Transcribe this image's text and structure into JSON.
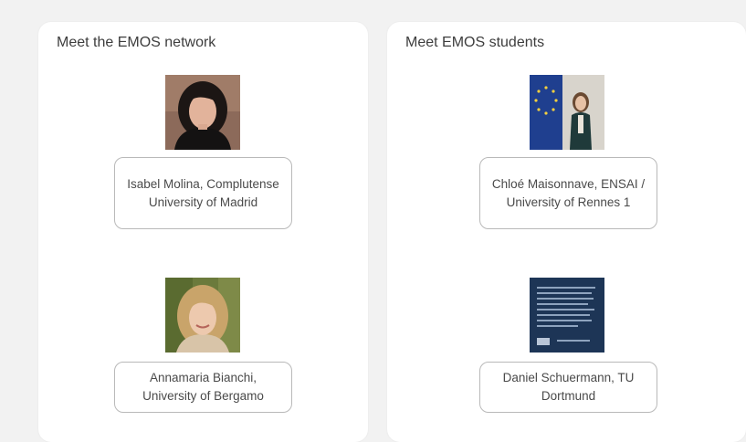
{
  "network": {
    "title": "Meet the EMOS network",
    "people": [
      {
        "name": "Isabel Molina, Complutense University of Madrid",
        "photo": "portrait-woman-dark-hair"
      },
      {
        "name": "Annamaria Bianchi, University of Bergamo",
        "photo": "portrait-woman-blonde-hair"
      }
    ]
  },
  "students": {
    "title": "Meet EMOS students",
    "people": [
      {
        "name": "Chloé Maisonnave, ENSAI / University of Rennes 1",
        "photo": "portrait-woman-eu-flag"
      },
      {
        "name": "Daniel Schuermann, TU Dortmund",
        "photo": "dark-blue-text-poster"
      }
    ]
  },
  "colors": {
    "page_bg": "#f2f2f2",
    "card_bg": "#ffffff",
    "box_border": "#b9b9b9",
    "eu_blue": "#1f3f8f",
    "poster_blue": "#1d3556"
  }
}
